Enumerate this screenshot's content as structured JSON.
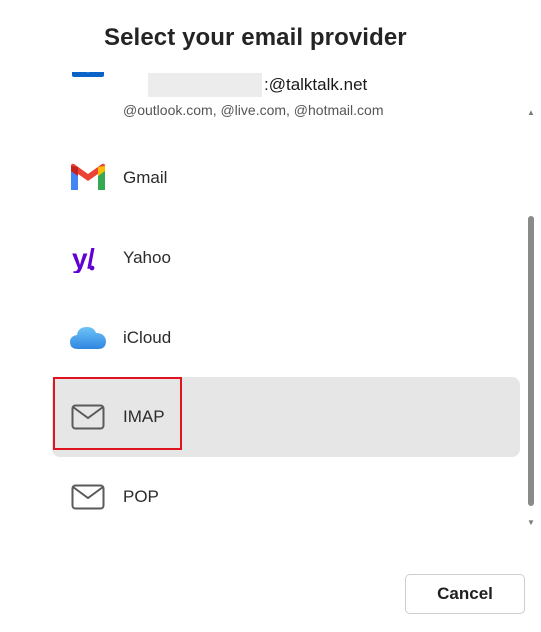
{
  "dialog": {
    "title": "Select your email provider",
    "account_email_suffix": ":@talktalk.net"
  },
  "providers": [
    {
      "id": "outlook",
      "label": "",
      "subtitle": "@outlook.com, @live.com, @hotmail.com",
      "icon": "outlook-icon"
    },
    {
      "id": "gmail",
      "label": "Gmail",
      "icon": "gmail-icon"
    },
    {
      "id": "yahoo",
      "label": "Yahoo",
      "icon": "yahoo-icon"
    },
    {
      "id": "icloud",
      "label": "iCloud",
      "icon": "icloud-icon"
    },
    {
      "id": "imap",
      "label": "IMAP",
      "icon": "envelope-icon",
      "selected": true
    },
    {
      "id": "pop",
      "label": "POP",
      "icon": "envelope-icon"
    }
  ],
  "footer": {
    "cancel_label": "Cancel"
  },
  "colors": {
    "selected_background": "#e6e6e6",
    "highlight_border": "#e0141e",
    "gmail_red": "#ea4335",
    "yahoo_purple": "#6001d2",
    "icloud_blue": "#3d9be9",
    "outlook_blue": "#0a64c8"
  }
}
